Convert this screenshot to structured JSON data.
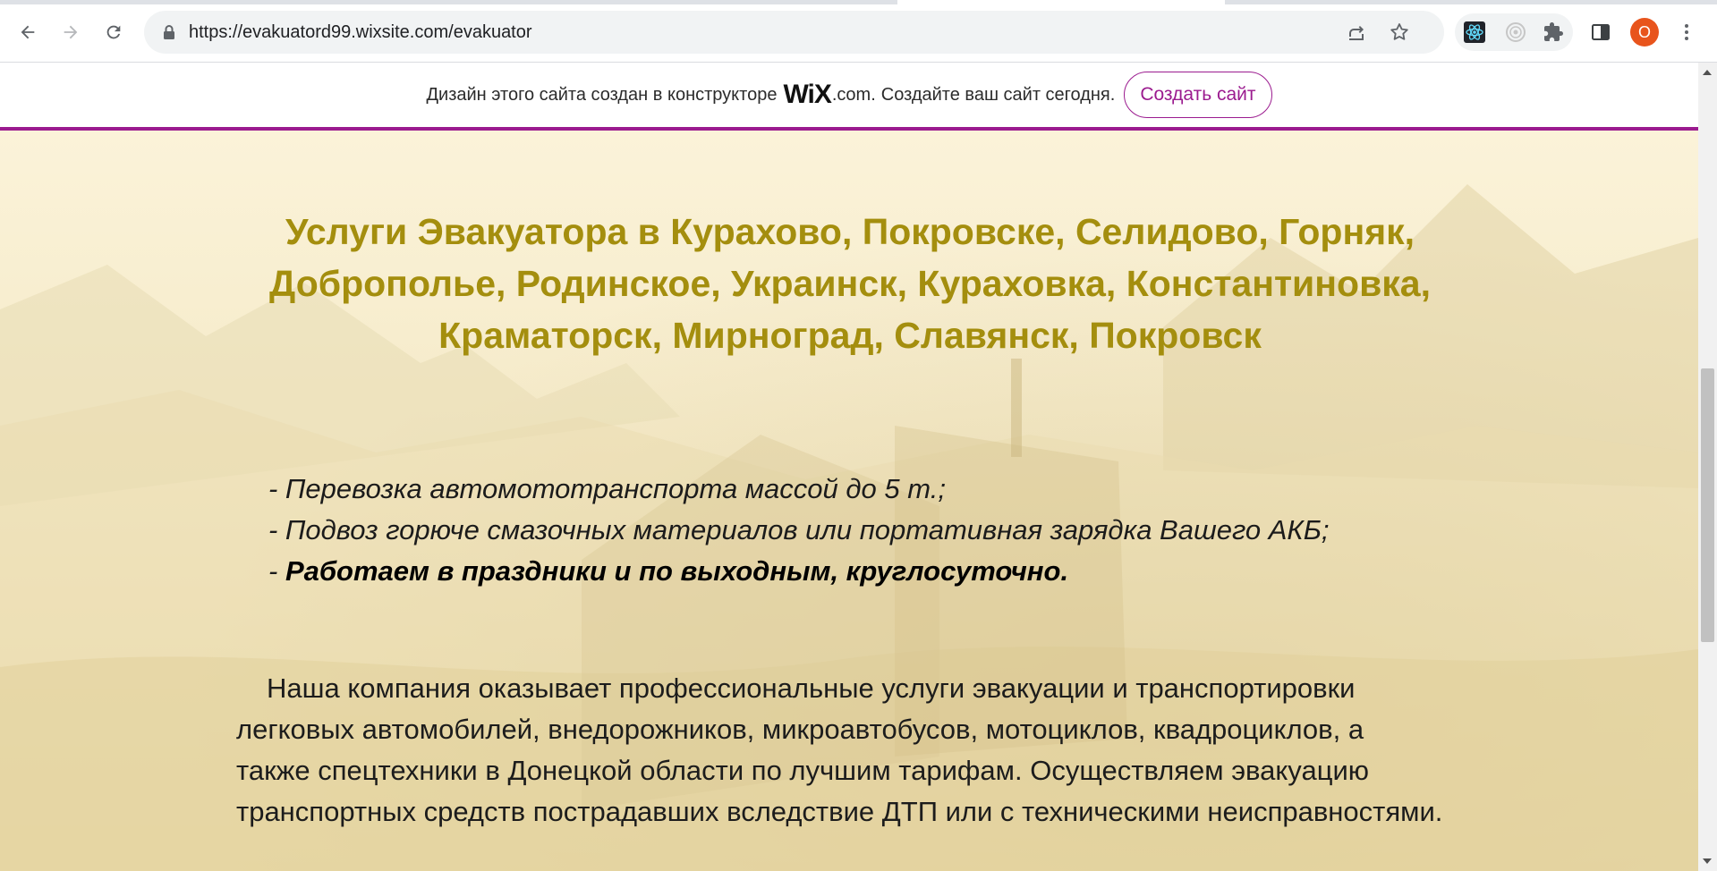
{
  "browser": {
    "url": "https://evakuatord99.wixsite.com/evakuator",
    "profile_initial": "O",
    "icons": {
      "back": "arrow-left-icon",
      "forward": "arrow-right-icon",
      "reload": "reload-icon",
      "lock": "lock-icon",
      "share": "share-icon",
      "bookmark": "star-icon",
      "extension_react": "react-icon",
      "extension_circle": "record-icon",
      "extensions": "puzzle-icon",
      "side_panel": "side-panel-icon",
      "menu": "kebab-menu-icon"
    }
  },
  "wix_banner": {
    "text_before": "Дизайн этого сайта создан в конструкторе",
    "logo": "WiX",
    "domain": ".com.",
    "text_after": "Создайте ваш сайт сегодня.",
    "button_label": "Создать сайт",
    "accent_color": "#9b1b8f"
  },
  "content": {
    "headline": "Услуги Эвакуатора в Курахово, Покровске, Селидово, Горняк, Доброполье, Родинское, Украинск, Кураховка, Константиновка, Краматорск, Мирноград, Славянск, Покровск",
    "headline_color": "#a48e0e",
    "bullets": [
      "- Перевозка автомототранспорта массой до 5 т.;",
      "- Подвоз горюче смазочных материалов или портативная зарядка Вашего АКБ;"
    ],
    "bullet_bold_prefix": "- ",
    "bullet_bold": "Работаем в праздники и по выходным, круглосуточно.",
    "paragraph": "Наша компания оказывает профессиональные услуги эвакуации и транспортировки легковых автомобилей, внедорожников, микроавтобусов, мотоциклов, квадроциклов, а также спецтехники в Донецкой области по лучшим тарифам. Осуществляем эвакуацию транспортных средств пострадавших вследствие ДТП или с техническими неисправностями."
  }
}
